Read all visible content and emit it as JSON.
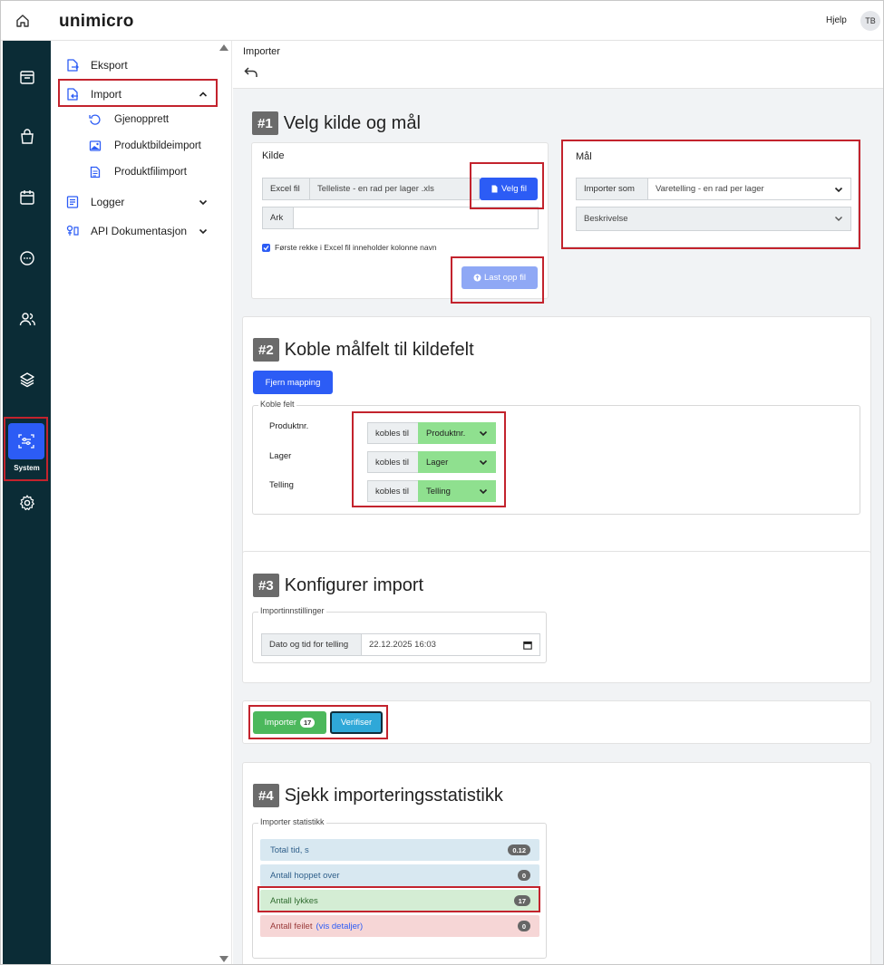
{
  "topbar": {
    "logo": "unimicro",
    "help": "Hjelp",
    "avatar": "TB"
  },
  "rail": {
    "items": [
      "home-icon",
      "inbox-icon",
      "bag-icon",
      "calendar-icon",
      "chat-icon",
      "users-icon",
      "layers-icon",
      "system-icon",
      "gear-icon"
    ],
    "active_label": "System"
  },
  "nav": {
    "items": [
      {
        "label": "Eksport"
      },
      {
        "label": "Import"
      },
      {
        "label": "Logger"
      },
      {
        "label": "API Dokumentasjon"
      }
    ],
    "import_sub": [
      {
        "label": "Gjenopprett"
      },
      {
        "label": "Produktbildeimport"
      },
      {
        "label": "Produktfilimport"
      }
    ]
  },
  "header": {
    "breadcrumb": "Importer"
  },
  "step1": {
    "num": "#1",
    "title": "Velg kilde og mål",
    "kilde": {
      "title": "Kilde",
      "excel_label": "Excel fil",
      "excel_value": "Telleliste - en rad per lager .xls",
      "choose_btn": "Velg fil",
      "ark_label": "Ark",
      "ark_value": "",
      "checkbox_label": "Første rekke i Excel fil inneholder kolonne navn",
      "checkbox_checked": true,
      "upload_btn": "Last opp fil"
    },
    "maal": {
      "title": "Mål",
      "import_as_label": "Importer som",
      "import_as_value": "Varetelling - en rad per lager",
      "description_label": "Beskrivelse"
    }
  },
  "step2": {
    "num": "#2",
    "title": "Koble målfelt til kildefelt",
    "remove_btn": "Fjern mapping",
    "legend": "Koble felt",
    "rows": [
      {
        "target": "Produktnr.",
        "connector": "kobles til",
        "source": "Produktnr."
      },
      {
        "target": "Lager",
        "connector": "kobles til",
        "source": "Lager"
      },
      {
        "target": "Telling",
        "connector": "kobles til",
        "source": "Telling"
      }
    ]
  },
  "step3": {
    "num": "#3",
    "title": "Konfigurer import",
    "legend": "Importinnstillinger",
    "date_label": "Dato og tid for telling",
    "date_value": "22.12.2025 16:03"
  },
  "actions": {
    "import_btn": "Importer",
    "import_count": "17",
    "verify_btn": "Verifiser"
  },
  "step4": {
    "num": "#4",
    "title": "Sjekk importeringsstatistikk",
    "legend": "Importer statistikk",
    "stats": [
      {
        "label": "Total tid, s",
        "value": "0.12"
      },
      {
        "label": "Antall hoppet over",
        "value": "0"
      },
      {
        "label": "Antall lykkes",
        "value": "17"
      },
      {
        "label": "Antall feilet",
        "link": "(vis detaljer)",
        "value": "0"
      }
    ]
  },
  "colors": {
    "rail_bg": "#0b2c36",
    "primary": "#2c5cf5",
    "success": "#4cb85c",
    "info": "#2fa8d8",
    "highlight": "#c3232d"
  }
}
